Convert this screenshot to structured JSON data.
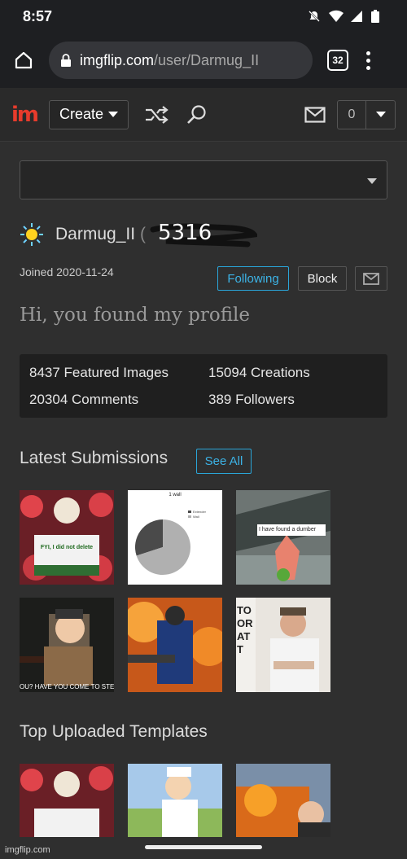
{
  "status_bar": {
    "time": "8:57",
    "icons": [
      "mute-icon",
      "wifi-icon",
      "signal-icon",
      "battery-icon"
    ]
  },
  "browser": {
    "url_host": "imgflip.com",
    "url_path": "/user/Darmug_II",
    "tab_count": "32"
  },
  "site_header": {
    "logo": "im",
    "create_label": "Create",
    "notification_count": "0"
  },
  "profile": {
    "username": "Darmug_II",
    "points_paren": "(",
    "points": "5316",
    "joined": "Joined 2020-11-24",
    "following_label": "Following",
    "block_label": "Block",
    "tagline": "Hi, you found my profile"
  },
  "stats": {
    "featured": "8437 Featured Images",
    "creations": "15094 Creations",
    "comments": "20304 Comments",
    "followers": "389 Followers"
  },
  "latest": {
    "title": "Latest Submissions",
    "see_all": "See All"
  },
  "templates": {
    "title": "Top Uploaded Templates"
  },
  "thumb_texts": {
    "fyi": "FYI, I did not delete",
    "piechart_title": "1 wall",
    "piechart_legend_a": "Extender",
    "piechart_legend_b": "Wall",
    "patrick": "I have found a dumber",
    "stanford": "OU? HAVE YOU COME TO STE",
    "toorat": "TO OR AT T"
  },
  "pie_chart": {
    "slices": [
      {
        "label": "Wall",
        "value": 70
      },
      {
        "label": "Extender",
        "value": 30
      }
    ]
  },
  "watermark": "imgflip.com"
}
